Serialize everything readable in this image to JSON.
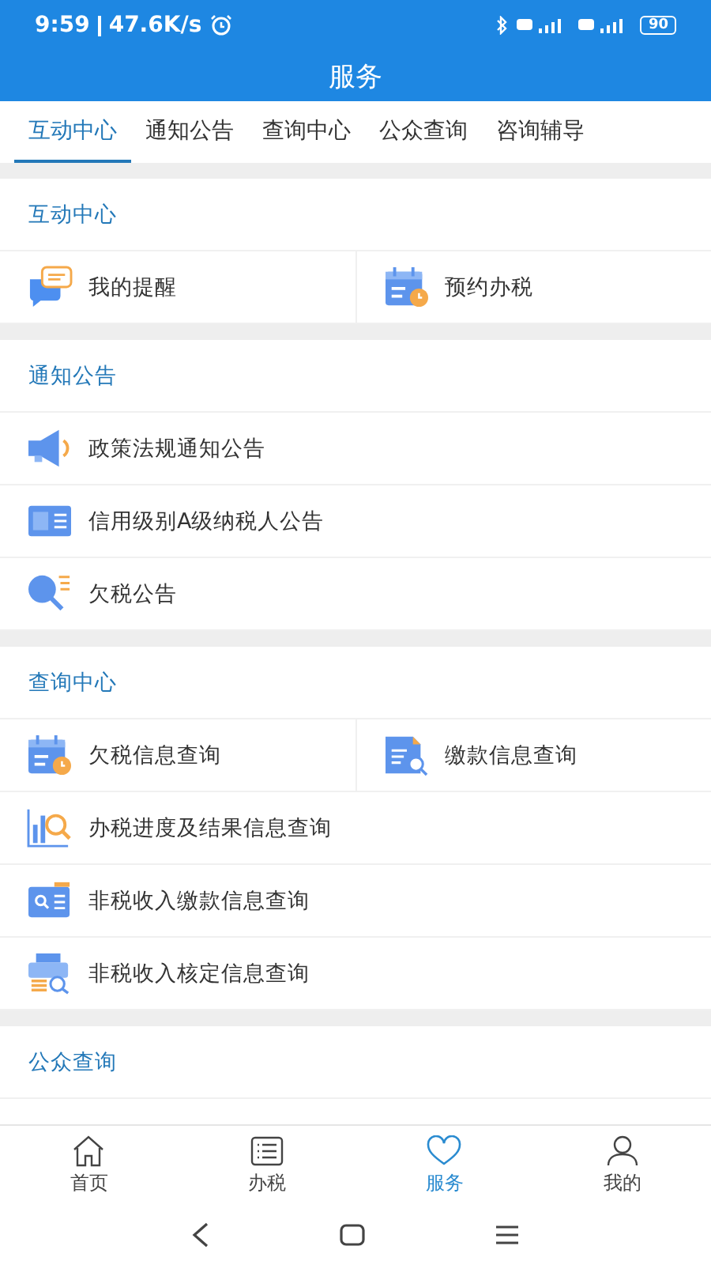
{
  "status_bar": {
    "time": "9:59",
    "speed": "47.6K/s",
    "battery": "90"
  },
  "title": "服务",
  "tabs": [
    {
      "label": "互动中心",
      "selected": true
    },
    {
      "label": "通知公告",
      "selected": false
    },
    {
      "label": "查询中心",
      "selected": false
    },
    {
      "label": "公众查询",
      "selected": false
    },
    {
      "label": "咨询辅导",
      "selected": false
    }
  ],
  "sections": [
    {
      "title": "互动中心",
      "rows": [
        [
          {
            "label": "我的提醒",
            "kind": "chat"
          },
          {
            "label": "预约办税",
            "kind": "calendar"
          }
        ]
      ]
    },
    {
      "title": "通知公告",
      "rows": [
        [
          {
            "label": "政策法规通知公告",
            "kind": "megaphone"
          }
        ],
        [
          {
            "label": "信用级别A级纳税人公告",
            "kind": "credit"
          }
        ],
        [
          {
            "label": "欠税公告",
            "kind": "searchlist"
          }
        ]
      ]
    },
    {
      "title": "查询中心",
      "rows": [
        [
          {
            "label": "欠税信息查询",
            "kind": "calendar"
          },
          {
            "label": "缴款信息查询",
            "kind": "docsearch"
          }
        ],
        [
          {
            "label": "办税进度及结果信息查询",
            "kind": "chart"
          }
        ],
        [
          {
            "label": "非税收入缴款信息查询",
            "kind": "card"
          }
        ],
        [
          {
            "label": "非税收入核定信息查询",
            "kind": "printer"
          }
        ]
      ]
    },
    {
      "title": "公众查询"
    }
  ],
  "bottom_nav": [
    {
      "label": "首页",
      "kind": "home",
      "selected": false
    },
    {
      "label": "办税",
      "kind": "list",
      "selected": false
    },
    {
      "label": "服务",
      "kind": "heart",
      "selected": true
    },
    {
      "label": "我的",
      "kind": "person",
      "selected": false
    }
  ]
}
